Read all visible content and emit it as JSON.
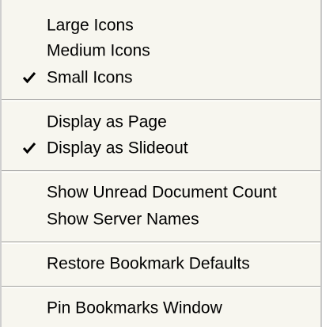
{
  "menu": {
    "groups": [
      {
        "items": [
          {
            "label": "Large Icons",
            "checked": false
          },
          {
            "label": "Medium Icons",
            "checked": false
          },
          {
            "label": "Small Icons",
            "checked": true
          }
        ]
      },
      {
        "items": [
          {
            "label": "Display as Page",
            "checked": false
          },
          {
            "label": "Display as Slideout",
            "checked": true
          }
        ]
      },
      {
        "items": [
          {
            "label": "Show Unread Document Count",
            "checked": false
          },
          {
            "label": "Show Server Names",
            "checked": false
          }
        ]
      },
      {
        "items": [
          {
            "label": "Restore Bookmark Defaults",
            "checked": false
          }
        ]
      },
      {
        "items": [
          {
            "label": "Pin Bookmarks Window",
            "checked": false
          }
        ]
      }
    ]
  },
  "icons": {
    "check": "checkmark-icon"
  }
}
